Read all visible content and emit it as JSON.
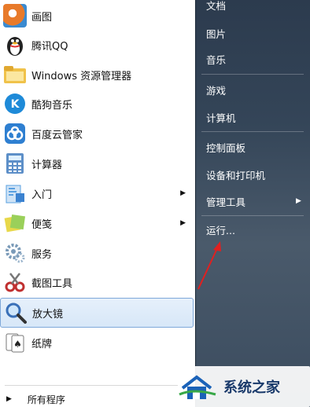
{
  "left_items": [
    {
      "label": "画图",
      "icon": "paint-icon",
      "color": "#e87a2a"
    },
    {
      "label": "腾讯QQ",
      "icon": "qq-penguin-icon",
      "color": "#222222"
    },
    {
      "label": "Windows 资源管理器",
      "icon": "folder-explorer-icon",
      "color": "#f0c24a"
    },
    {
      "label": "酷狗音乐",
      "icon": "kugou-icon",
      "color": "#1e8ad8"
    },
    {
      "label": "百度云管家",
      "icon": "baidu-cloud-icon",
      "color": "#2e7fd1"
    },
    {
      "label": "计算器",
      "icon": "calculator-icon",
      "color": "#4a8bd0"
    },
    {
      "label": "入门",
      "icon": "getting-started-icon",
      "color": "#5aa0e0",
      "submenu": true
    },
    {
      "label": "便笺",
      "icon": "sticky-notes-icon",
      "color": "#e8d84a",
      "submenu": true
    },
    {
      "label": "服务",
      "icon": "services-gear-icon",
      "color": "#7a9ab8"
    },
    {
      "label": "截图工具",
      "icon": "snipping-tool-icon",
      "color": "#c03030"
    },
    {
      "label": "放大镜",
      "icon": "magnifier-icon",
      "color": "#3a70b8",
      "selected": true
    },
    {
      "label": "纸牌",
      "icon": "solitaire-icon",
      "color": "#2a7a3a"
    }
  ],
  "all_programs": "所有程序",
  "right_items": [
    "文档",
    "图片",
    "音乐",
    "游戏",
    "计算机",
    "控制面板",
    "设备和打印机",
    "管理工具",
    "运行..."
  ],
  "watermark": {
    "text": "系统之家"
  },
  "colors": {
    "selection": "#d7e7f8",
    "right_panel": "#344558",
    "annotation_arrow": "#e02020"
  }
}
